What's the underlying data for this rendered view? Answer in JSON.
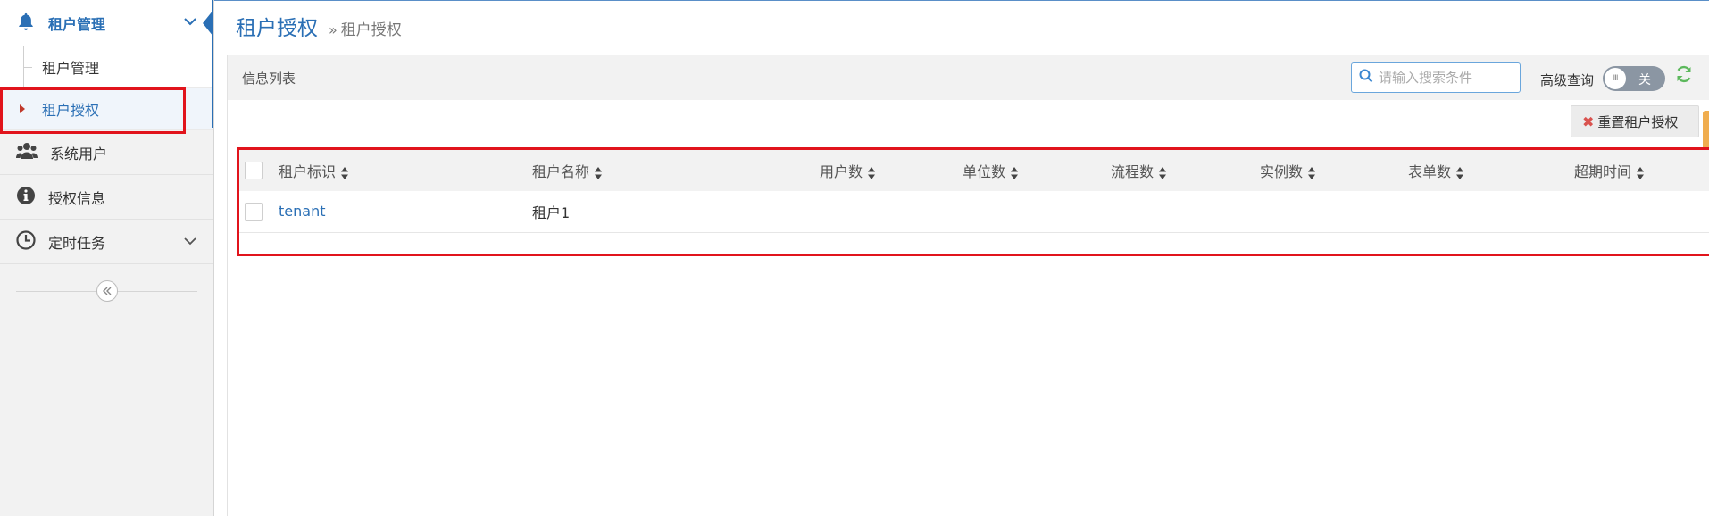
{
  "sidebar": {
    "header": {
      "label": "租户管理",
      "icon": "bell-icon"
    },
    "sub_items": [
      {
        "label": "租户管理",
        "active": false
      },
      {
        "label": "租户授权",
        "active": true
      }
    ],
    "nav_items": [
      {
        "label": "系统用户",
        "icon": "users-icon"
      },
      {
        "label": "授权信息",
        "icon": "info-circle-icon"
      },
      {
        "label": "定时任务",
        "icon": "clock-icon"
      }
    ],
    "collapse_icon": "double-chevron-left-icon"
  },
  "breadcrumb": {
    "title": "租户授权",
    "separator": "»",
    "current": "租户授权"
  },
  "panel": {
    "title": "信息列表",
    "search_placeholder": "请输入搜索条件",
    "advanced_label": "高级查询",
    "toggle_text": "关",
    "toggle_knob": "III",
    "reset_button": "重置租户授权"
  },
  "table": {
    "columns": [
      "租户标识",
      "租户名称",
      "用户数",
      "单位数",
      "流程数",
      "实例数",
      "表单数",
      "超期时间"
    ],
    "rows": [
      [
        "tenant",
        "租户1",
        "",
        "",
        "",
        "",
        "",
        ""
      ]
    ]
  },
  "colors": {
    "accent": "#2a6fb5",
    "highlight": "#e1141c",
    "refresh": "#5cb85c"
  }
}
